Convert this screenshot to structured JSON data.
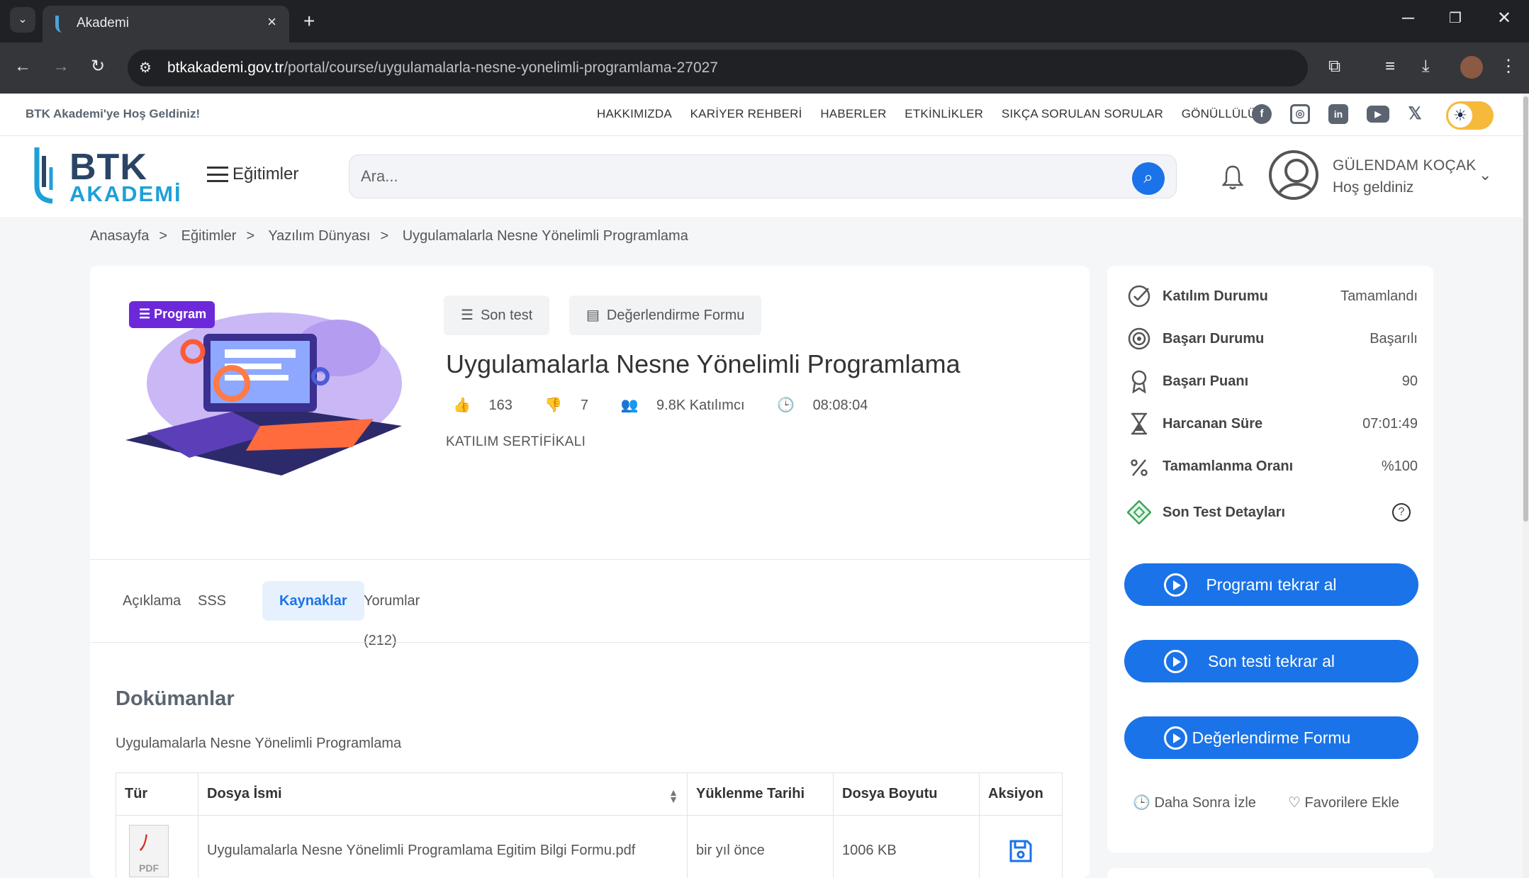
{
  "browser": {
    "tab_title": "Akademi",
    "url_domain": "btkakademi.gov.tr",
    "url_path": "/portal/course/uygulamalarla-nesne-yonelimli-programlama-27027"
  },
  "topbar": {
    "welcome": "BTK Akademi'ye Hoş Geldiniz!",
    "nav": [
      "HAKKIMIZDA",
      "KARİYER REHBERİ",
      "HABERLER",
      "ETKİNLİKLER",
      "SIKÇA SORULAN SORULAR",
      "GÖNÜLLÜLÜK"
    ],
    "social_icons": [
      "facebook-icon",
      "instagram-icon",
      "linkedin-icon",
      "youtube-icon",
      "x-icon"
    ],
    "theme_icon": "sun-icon"
  },
  "header": {
    "logo_top": "BTK",
    "logo_bottom": "AKADEMİ",
    "menu_label": "Eğitimler",
    "search_placeholder": "Ara...",
    "user_name": "GÜLENDAM KOÇAK",
    "user_greeting": "Hoş geldiniz"
  },
  "breadcrumb": [
    "Anasayfa",
    "Eğitimler",
    "Yazılım Dünyası",
    "Uygulamalarla Nesne Yönelimli Programlama"
  ],
  "course": {
    "badge": "Program",
    "btn_last_test": "Son test",
    "btn_eval_form": "Değerlendirme Formu",
    "title": "Uygulamalarla Nesne Yönelimli Programlama",
    "likes": "163",
    "dislikes": "7",
    "participants": "9.8K Katılımcı",
    "duration": "08:08:04",
    "certificate": "KATILIM SERTİFİKALI"
  },
  "tabs": [
    "Açıklama",
    "SSS",
    "Kaynaklar",
    "Yorumlar (212)"
  ],
  "active_tab": "Kaynaklar",
  "documents": {
    "heading": "Dokümanlar",
    "subheading": "Uygulamalarla Nesne Yönelimli Programlama",
    "columns": [
      "Tür",
      "Dosya İsmi",
      "Yüklenme Tarihi",
      "Dosya Boyutu",
      "Aksiyon"
    ],
    "rows": [
      {
        "type_label": "PDF",
        "name": "Uygulamalarla Nesne Yönelimli Programlama Egitim Bilgi Formu.pdf",
        "uploaded": "bir yıl önce",
        "size": "1006 KB"
      }
    ]
  },
  "sidebar": {
    "status": [
      {
        "label": "Katılım Durumu",
        "value": "Tamamlandı",
        "icon": "check-circle-icon"
      },
      {
        "label": "Başarı Durumu",
        "value": "Başarılı",
        "icon": "target-icon"
      },
      {
        "label": "Başarı Puanı",
        "value": "90",
        "icon": "award-icon"
      },
      {
        "label": "Harcanan Süre",
        "value": "07:01:49",
        "icon": "hourglass-icon"
      },
      {
        "label": "Tamamlanma Oranı",
        "value": "%100",
        "icon": "percent-icon"
      },
      {
        "label": "Son Test Detayları",
        "value": "",
        "icon": "test-detail-icon"
      }
    ],
    "buttons": [
      "Programı tekrar al",
      "Son testi tekrar al",
      "Değerlendirme Formu"
    ],
    "watch_later": "Daha Sonra İzle",
    "add_favorite": "Favorilere Ekle"
  },
  "colors": {
    "primary": "#1a73e8",
    "badge": "#6d28d9",
    "toggle": "#f6b93b"
  }
}
